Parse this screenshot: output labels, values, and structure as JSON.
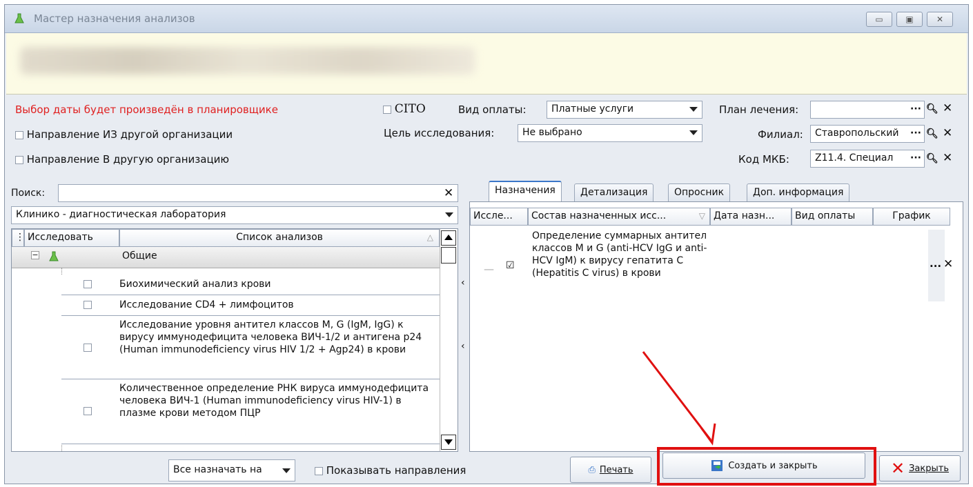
{
  "window": {
    "title": "Мастер назначения анализов"
  },
  "top": {
    "date_hint": "Выбор даты будет произведён в планировщике",
    "cito_label": "CITO",
    "dir_from_label": "Направление ИЗ другой организации",
    "dir_to_label": "Направление В другую организацию",
    "payment_label": "Вид оплаты:",
    "payment_value": "Платные услуги",
    "purpose_label": "Цель исследования:",
    "purpose_value": "Не выбрано",
    "plan_label": "План лечения:",
    "plan_value": "",
    "branch_label": "Филиал:",
    "branch_value": "Ставропольский",
    "mkb_label": "Код МКБ:",
    "mkb_value": "Z11.4. Специал"
  },
  "left": {
    "search_label": "Поиск:",
    "search_value": "",
    "lab_value": "Клинико - диагностическая лаборатория",
    "col_investigate": "Исследовать",
    "col_list": "Список анализов",
    "group": "Общие",
    "items": [
      "Биохимический анализ крови",
      "Исследование CD4 + лимфоцитов",
      "Исследование уровня антител классов M, G (IgM, IgG) к вирусу иммунодефицита человека ВИЧ-1/2 и антигена p24 (Human immunodeficiency virus HIV 1/2 + Agp24) в крови",
      "Количественное определение РНК вируса иммунодефицита человека ВИЧ-1 (Human immunodeficiency virus HIV-1) в плазме крови методом ПЦР"
    ]
  },
  "right": {
    "tabs": [
      "Назначения",
      "Детализация",
      "Опросник",
      "Доп. информация"
    ],
    "cols": [
      "Иссле...",
      "Состав назначенных исс...",
      "Дата назн...",
      "Вид оплаты",
      "График"
    ],
    "row_text": "Определение суммарных антител классов M и G (anti-HCV IgG и anti-HCV IgM) к вирусу гепатита C (Hepatitis C virus) в крови"
  },
  "bottom": {
    "assign_all": "Все назначать на",
    "show_dirs": "Показывать направления",
    "print": "Печать",
    "create_close": "Создать и закрыть",
    "close": "Закрыть"
  },
  "colors": {
    "highlight": "#e01010",
    "accent": "#3a76c8"
  }
}
